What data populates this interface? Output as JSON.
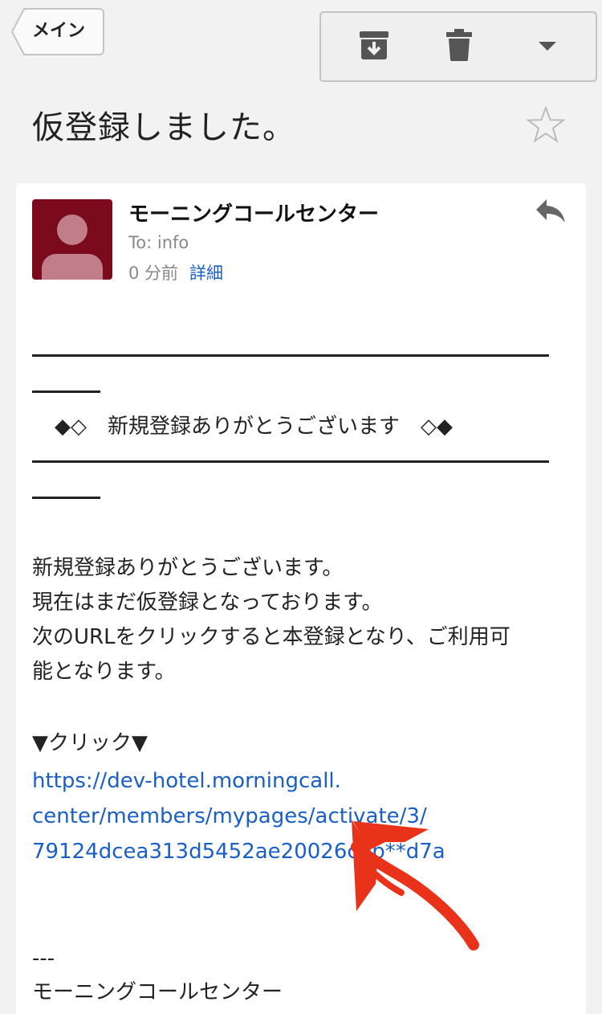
{
  "nav": {
    "back_label": "メイン"
  },
  "toolbar": {
    "archive_icon": "archive-icon",
    "delete_icon": "trash-icon",
    "more_icon": "caret-down-icon"
  },
  "email": {
    "subject": "仮登録しました。",
    "sender": "モーニングコールセンター",
    "to": "To: info",
    "time": "0 分前",
    "details_label": "詳細",
    "banner": "◆◇　新規登録ありがとうございます　◇◆",
    "body_lines": [
      "新規登録ありがとうございます。",
      "現在はまだ仮登録となっております。",
      "次のURLをクリックすると本登録となり、ご利用可",
      "能となります。"
    ],
    "click_label": "▼クリック▼",
    "link_lines": [
      "https://dev-hotel.morningcall.",
      "center/members/mypages/activate/3/",
      "79124dcea313d5452ae20026c5b**d7a"
    ],
    "sig_dashes": "---",
    "signature": "モーニングコールセンター"
  },
  "colors": {
    "avatar_bg": "#7b0a1d",
    "link": "#1a5fc8",
    "annotation_arrow": "#e8321a"
  }
}
